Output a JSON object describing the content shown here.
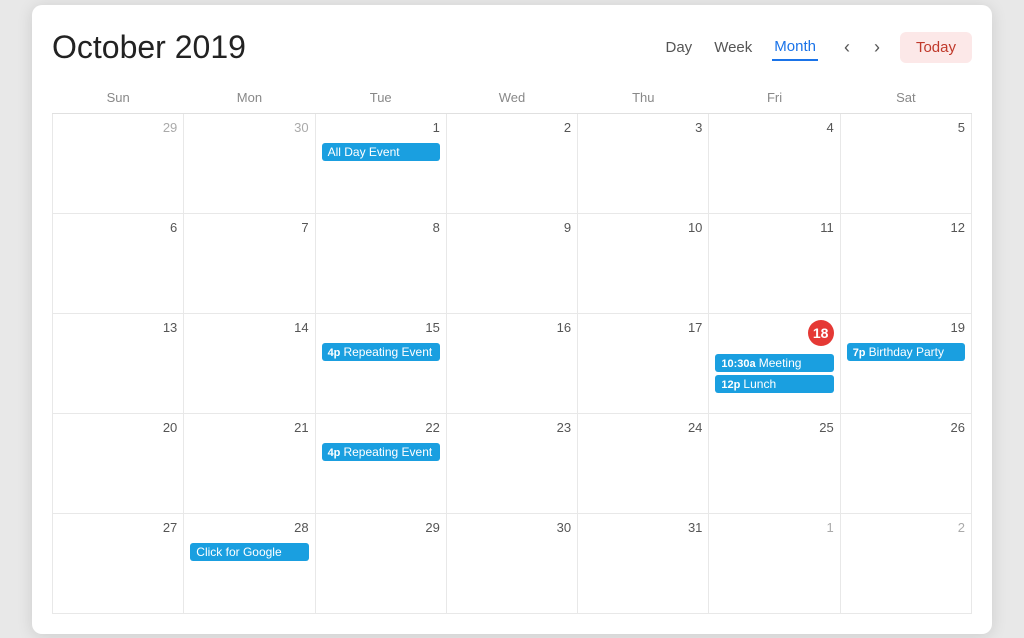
{
  "header": {
    "title": "October 2019",
    "views": [
      "Day",
      "Week",
      "Month"
    ],
    "active_view": "Month",
    "today_label": "Today"
  },
  "calendar": {
    "days_of_week": [
      "Sun",
      "Mon",
      "Tue",
      "Wed",
      "Thu",
      "Fri",
      "Sat"
    ],
    "weeks": [
      [
        {
          "day": "29",
          "current": false,
          "today": false,
          "events": []
        },
        {
          "day": "30",
          "current": false,
          "today": false,
          "events": []
        },
        {
          "day": "1",
          "current": true,
          "today": false,
          "events": [
            {
              "label": "All Day Event",
              "time_prefix": "",
              "type": "blue"
            }
          ]
        },
        {
          "day": "2",
          "current": true,
          "today": false,
          "events": []
        },
        {
          "day": "3",
          "current": true,
          "today": false,
          "events": []
        },
        {
          "day": "4",
          "current": true,
          "today": false,
          "events": []
        },
        {
          "day": "5",
          "current": true,
          "today": false,
          "events": []
        }
      ],
      [
        {
          "day": "6",
          "current": true,
          "today": false,
          "events": []
        },
        {
          "day": "7",
          "current": true,
          "today": false,
          "events": []
        },
        {
          "day": "8",
          "current": true,
          "today": false,
          "events": []
        },
        {
          "day": "9",
          "current": true,
          "today": false,
          "events": []
        },
        {
          "day": "10",
          "current": true,
          "today": false,
          "events": []
        },
        {
          "day": "11",
          "current": true,
          "today": false,
          "events": []
        },
        {
          "day": "12",
          "current": true,
          "today": false,
          "events": []
        }
      ],
      [
        {
          "day": "13",
          "current": true,
          "today": false,
          "events": []
        },
        {
          "day": "14",
          "current": true,
          "today": false,
          "events": []
        },
        {
          "day": "15",
          "current": true,
          "today": false,
          "events": [
            {
              "label": "Repeating Event",
              "time_prefix": "4p",
              "type": "blue"
            }
          ]
        },
        {
          "day": "16",
          "current": true,
          "today": false,
          "events": []
        },
        {
          "day": "17",
          "current": true,
          "today": false,
          "events": []
        },
        {
          "day": "18",
          "current": true,
          "today": true,
          "events": [
            {
              "label": "Meeting",
              "time_prefix": "10:30a",
              "type": "blue"
            },
            {
              "label": "Lunch",
              "time_prefix": "12p",
              "type": "blue"
            }
          ]
        },
        {
          "day": "19",
          "current": true,
          "today": false,
          "events": [
            {
              "label": "Birthday Party",
              "time_prefix": "7p",
              "type": "blue"
            }
          ]
        }
      ],
      [
        {
          "day": "20",
          "current": true,
          "today": false,
          "events": []
        },
        {
          "day": "21",
          "current": true,
          "today": false,
          "events": []
        },
        {
          "day": "22",
          "current": true,
          "today": false,
          "events": [
            {
              "label": "Repeating Event",
              "time_prefix": "4p",
              "type": "blue"
            }
          ]
        },
        {
          "day": "23",
          "current": true,
          "today": false,
          "events": []
        },
        {
          "day": "24",
          "current": true,
          "today": false,
          "events": []
        },
        {
          "day": "25",
          "current": true,
          "today": false,
          "events": []
        },
        {
          "day": "26",
          "current": true,
          "today": false,
          "events": []
        }
      ],
      [
        {
          "day": "27",
          "current": true,
          "today": false,
          "events": []
        },
        {
          "day": "28",
          "current": true,
          "today": false,
          "events": [
            {
              "label": "Click for Google",
              "time_prefix": "",
              "type": "blue"
            }
          ]
        },
        {
          "day": "29",
          "current": true,
          "today": false,
          "events": []
        },
        {
          "day": "30",
          "current": true,
          "today": false,
          "events": []
        },
        {
          "day": "31",
          "current": true,
          "today": false,
          "events": []
        },
        {
          "day": "1",
          "current": false,
          "today": false,
          "events": []
        },
        {
          "day": "2",
          "current": false,
          "today": false,
          "events": []
        }
      ]
    ]
  }
}
